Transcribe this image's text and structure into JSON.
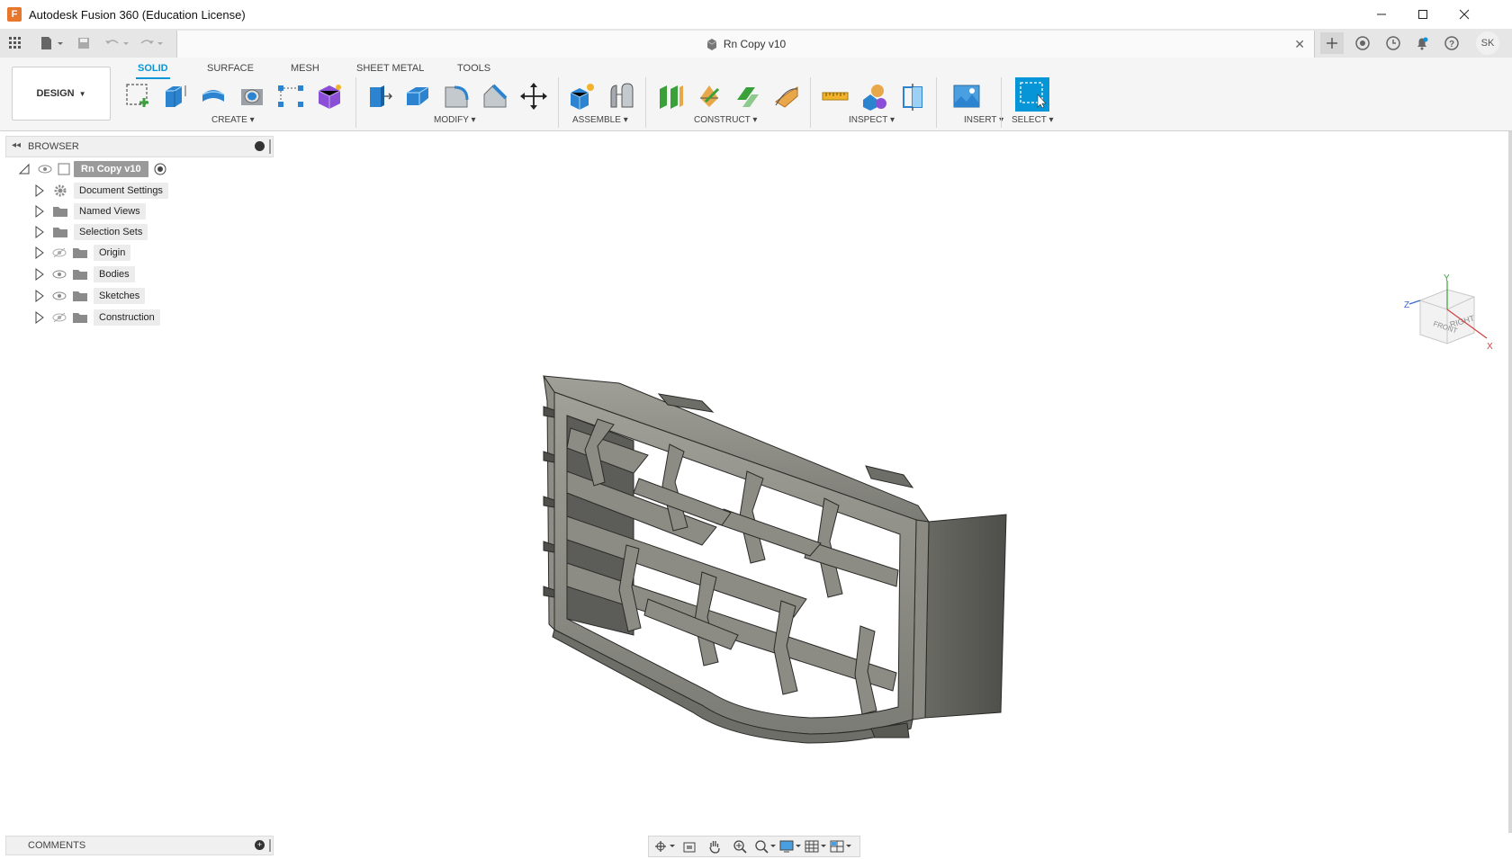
{
  "window": {
    "title": "Autodesk Fusion 360 (Education License)",
    "logo_letter": "F"
  },
  "document": {
    "tab_title": "Rn Copy v10"
  },
  "user": {
    "initials": "SK"
  },
  "ribbon": {
    "workspace_label": "DESIGN",
    "tabs": [
      "SOLID",
      "SURFACE",
      "MESH",
      "SHEET METAL",
      "TOOLS"
    ],
    "active_tab": "SOLID",
    "groups": {
      "create": "CREATE",
      "modify": "MODIFY",
      "assemble": "ASSEMBLE",
      "construct": "CONSTRUCT",
      "inspect": "INSPECT",
      "insert": "INSERT",
      "select": "SELECT"
    }
  },
  "browser": {
    "title": "BROWSER",
    "root": "Rn Copy v10",
    "items": [
      "Document Settings",
      "Named Views",
      "Selection Sets",
      "Origin",
      "Bodies",
      "Sketches",
      "Construction"
    ]
  },
  "comments": {
    "title": "COMMENTS"
  },
  "viewcube": {
    "front": "FRONT",
    "right": "RIGHT",
    "axis_x": "X",
    "axis_y": "Y",
    "axis_z": "Z"
  },
  "colors": {
    "accent": "#0696d7",
    "model": "#8a8a82",
    "model_dark": "#4e4e4a",
    "model_light": "#a8a8a0"
  }
}
